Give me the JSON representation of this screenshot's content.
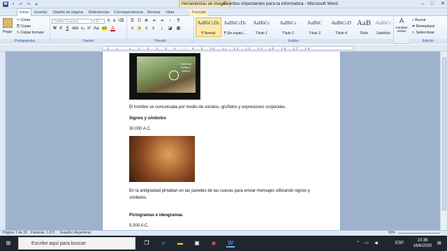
{
  "title_bar": {
    "context_tab": "Herramientas de imagen",
    "title": "Eventos importantes para la informatica - Microsoft Word",
    "minimize": "–",
    "maximize": "□",
    "close": "✕"
  },
  "tabs": [
    "Inicio",
    "Insertar",
    "Diseño de página",
    "Referencias",
    "Correspondencia",
    "Revisar",
    "Vista",
    "Formato"
  ],
  "ribbon": {
    "clipboard": {
      "paste": "Pegar",
      "cut": "Cortar",
      "copy": "Copiar",
      "format_painter": "Copiar formato",
      "label": "Portapapeles"
    },
    "font": {
      "font_name": "Calibri (Cuerpo)",
      "font_size": "11",
      "label": "Fuente",
      "bold": "N",
      "italic": "K",
      "underline": "S"
    },
    "paragraph": {
      "label": "Párrafo"
    },
    "styles": {
      "label": "Estilos",
      "items": [
        {
          "sample": "AaBbCcDc",
          "name": "¶ Normal"
        },
        {
          "sample": "AaBbCcDc",
          "name": "¶ Sin espaci..."
        },
        {
          "sample": "AaBbCc",
          "name": "Título 1"
        },
        {
          "sample": "AaBbCc",
          "name": "Título 2"
        },
        {
          "sample": "AaBbC",
          "name": "Título 3"
        },
        {
          "sample": "AaBbCcD",
          "name": "Título 4"
        },
        {
          "sample": "AaB",
          "name": "Título"
        },
        {
          "sample": "AaBbCc",
          "name": "Subtítulo"
        }
      ],
      "change_styles": "Cambiar estilos"
    },
    "editing": {
      "label": "Edición",
      "find": "Buscar",
      "replace": "Reemplazar",
      "select": "Seleccionar"
    }
  },
  "ruler": {
    "ticks": "· 2 · 1 · · 1 · 2 · 3 · 4 · 5 · 6 · 7 · 8 · 9 · 10 · 11 · 12 · 13 · 14 · 15 · 16 · 17 · 18"
  },
  "document": {
    "image1_caption": "Hombres Señas y Gestos",
    "p1": "El hombre se comunicaba por medio de sonidos, gruñidos y expresiones corporales.",
    "h_signos": "Signos y ",
    "h_signos_italic": "símbolos",
    "date1": "30.000 A.C.",
    "p2_line1": "En la antigüedad pintaban en las paredes de las cuevas para enviar mensajes utilizando signos y",
    "p2_line2": "símbolos.",
    "h_pictogramas": "Pictogramas e ideogramas",
    "date2": "5.000 A.C."
  },
  "status_bar": {
    "page": "Página: 1 de 15",
    "words": "Palabras: 1.071",
    "language": "Español (Argentina)",
    "zoom": "90%"
  },
  "taskbar": {
    "search_placeholder": "Escribe aquí para buscar",
    "lang": "ESP",
    "time": "10:36",
    "date": "16/6/2020"
  }
}
